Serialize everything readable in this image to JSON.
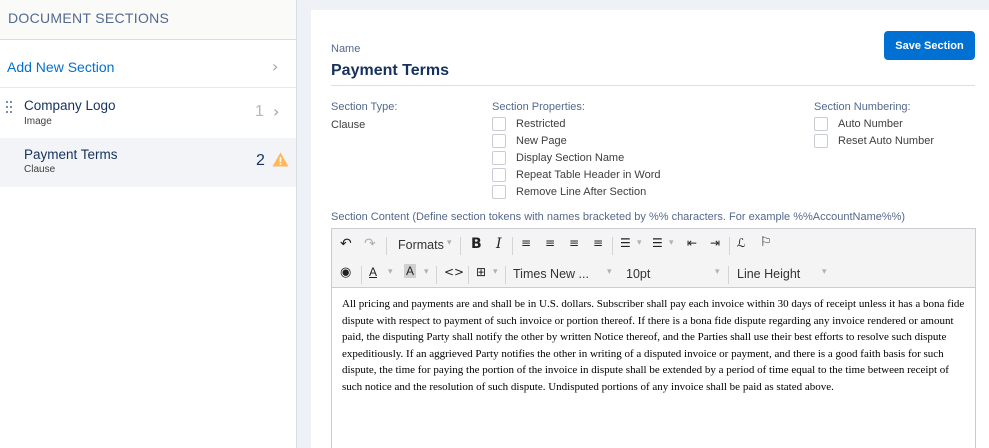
{
  "left_panel": {
    "header": "DOCUMENT SECTIONS",
    "add_section_label": "Add New Section",
    "sections": [
      {
        "title": "Company Logo",
        "type": "Image",
        "number": "1"
      },
      {
        "title": "Payment Terms",
        "type": "Clause",
        "number": "2",
        "warning": true
      }
    ]
  },
  "form": {
    "name_label": "Name",
    "name_value": "Payment Terms",
    "save_label": "Save Section",
    "section_type_label": "Section Type:",
    "section_type_value": "Clause",
    "properties_label": "Section Properties:",
    "properties": [
      "Restricted",
      "New Page",
      "Display Section Name",
      "Repeat Table Header in Word",
      "Remove Line After Section"
    ],
    "numbering_label": "Section Numbering:",
    "numbering": [
      "Auto Number",
      "Reset Auto Number"
    ],
    "content_label": "Section Content (Define section tokens with names bracketed by %% characters. For example %%AccountName%%)"
  },
  "editor": {
    "formats_label": "Formats",
    "font_family": "Times New ...",
    "font_size": "10pt",
    "line_height": "Line Height",
    "content": "All pricing and payments are and shall be in U.S. dollars. Subscriber shall pay each invoice within 30 days of receipt unless it has a bona fide dispute with respect to payment of such invoice or portion thereof. If there is a bona fide dispute regarding any invoice rendered or amount paid, the disputing Party shall notify the other by written Notice thereof, and the Parties shall use their best efforts to resolve such dispute expeditiously. If an aggrieved Party notifies the other in writing of a disputed invoice or payment, and there is a good faith basis for such dispute, the time for paying the portion of the invoice in dispute shall be extended by a period of time equal to the time between receipt of such notice and the resolution of such dispute. Undisputed portions of any invoice shall be paid as stated above."
  },
  "colors": {
    "accent": "#0070d2",
    "warning": "#ffb75d",
    "text": "#16325c"
  }
}
